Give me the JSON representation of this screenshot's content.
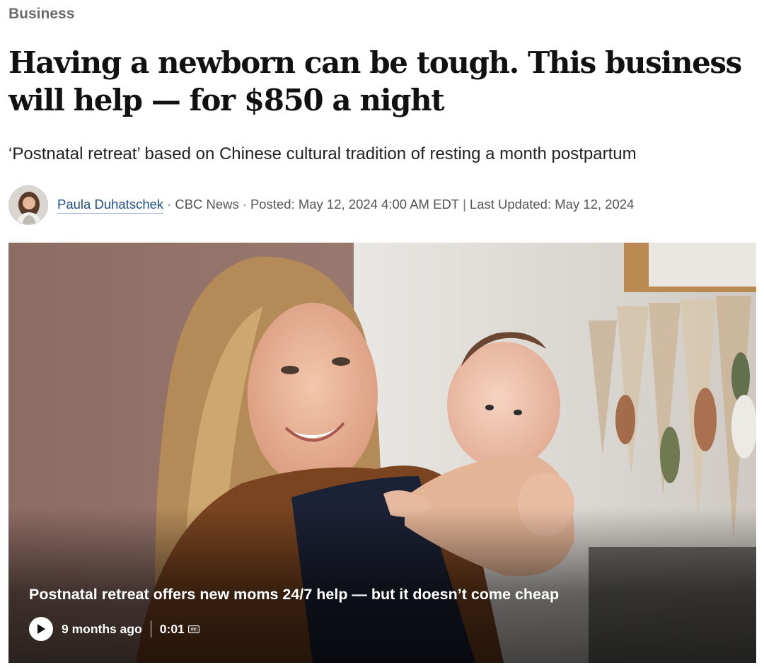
{
  "section": {
    "label": "Business"
  },
  "article": {
    "headline": "Having a newborn can be tough. This business will help — for $850 a night",
    "deck": "‘Postnatal retreat’ based on Chinese cultural tradition of resting a month postpartum"
  },
  "byline": {
    "author": "Paula Duhatschek",
    "separator": "·",
    "source": "CBC News",
    "posted": "Posted: May 12, 2024 4:00 AM EDT",
    "pipe": "|",
    "updated": "Last Updated: May 12, 2024"
  },
  "video": {
    "title": "Postnatal retreat offers new moms 24/7 help — but it doesn’t come cheap",
    "age": "9 months ago",
    "duration": "0:01",
    "cc_label": "cc"
  },
  "colors": {
    "section": "#6b6b6b",
    "author_link": "#1f4d8c",
    "headline": "#111111"
  },
  "icons": {
    "play": "play-icon",
    "closed_captions": "closed-captions-icon"
  }
}
